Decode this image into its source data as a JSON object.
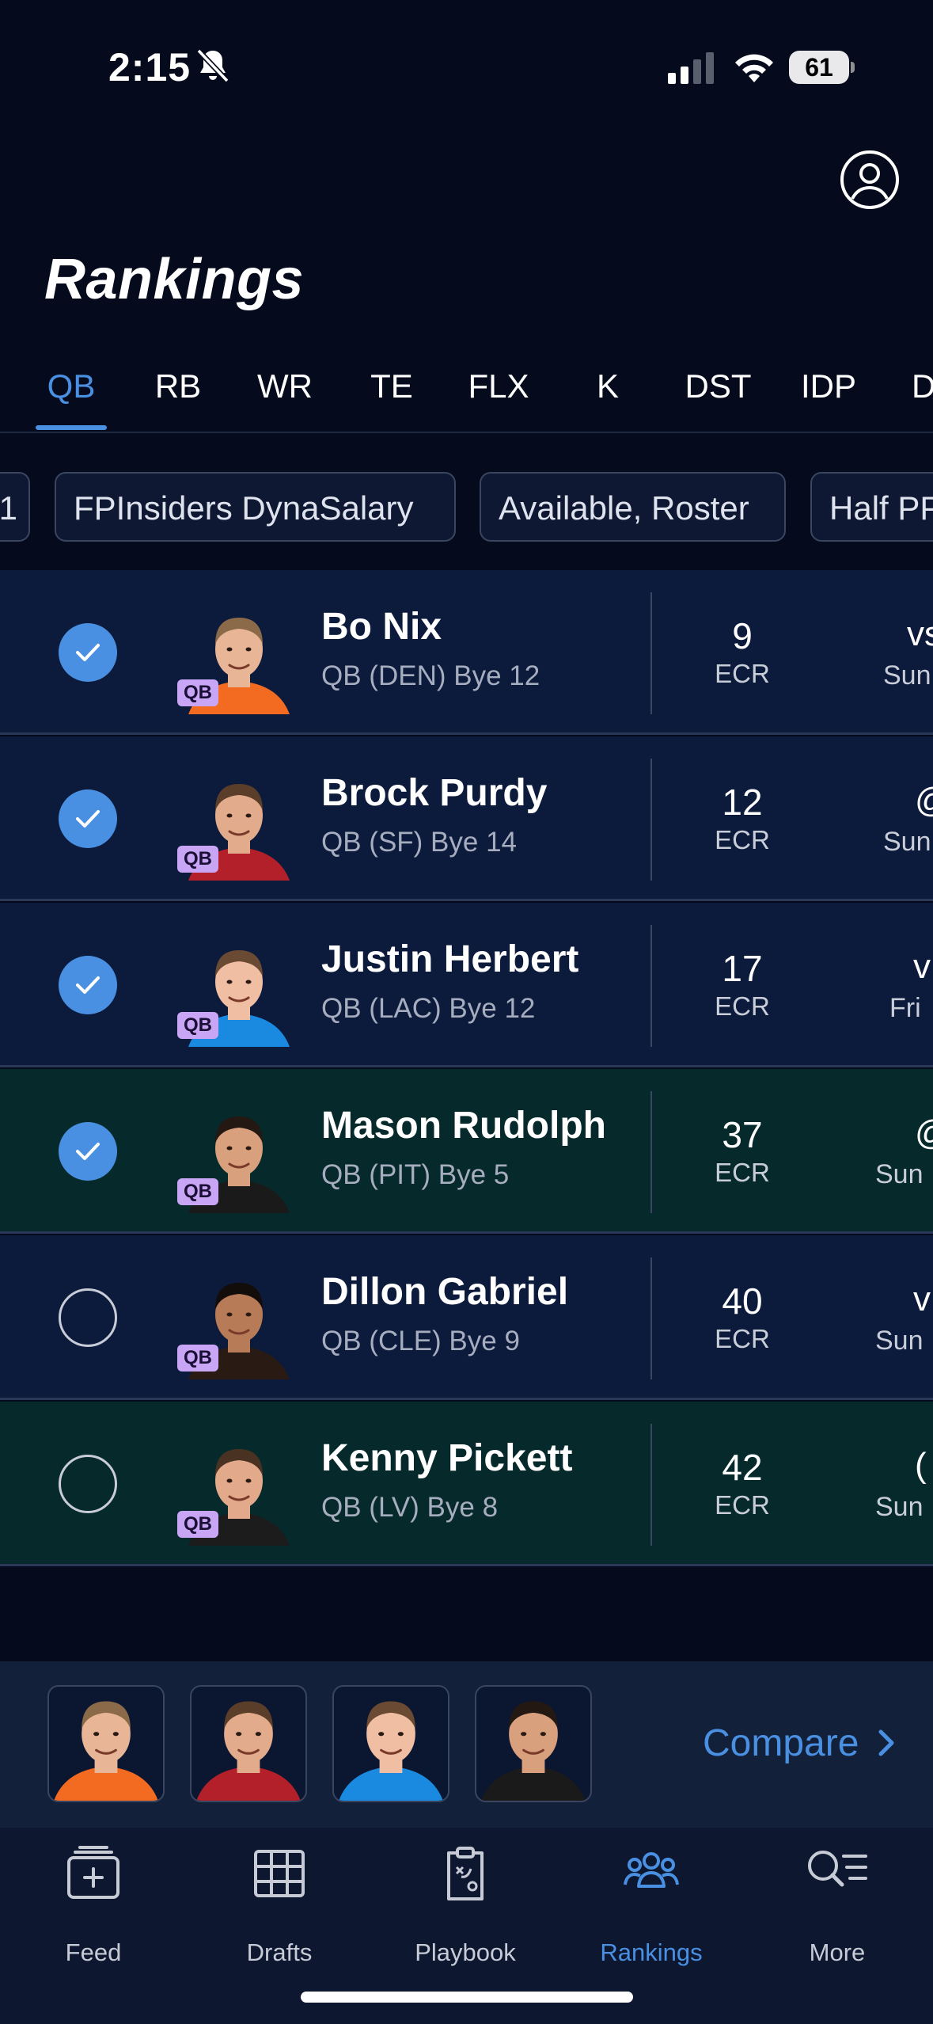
{
  "status_bar": {
    "time": "2:15",
    "battery": "61"
  },
  "header": {
    "title": "Rankings"
  },
  "tabs": [
    {
      "label": "QB",
      "active": true
    },
    {
      "label": "RB"
    },
    {
      "label": "WR"
    },
    {
      "label": "TE"
    },
    {
      "label": "FLX"
    },
    {
      "label": "K"
    },
    {
      "label": "DST"
    },
    {
      "label": "IDP"
    },
    {
      "label": "D"
    }
  ],
  "filters": [
    {
      "label": "1"
    },
    {
      "label": "FPInsiders DynaSalary"
    },
    {
      "label": "Available, Roster"
    },
    {
      "label": "Half PP"
    }
  ],
  "players": [
    {
      "name": "Bo Nix",
      "info": "QB (DEN) Bye 12",
      "pos": "QB",
      "ecr": "9",
      "ecr_label": "ECR",
      "opp": "vs",
      "day": "Sun",
      "checked": true,
      "row_color": "blue",
      "jersey": "#f36b21",
      "skin": "#e8b596",
      "hair": "#8b6a4a"
    },
    {
      "name": "Brock Purdy",
      "info": "QB (SF) Bye 14",
      "pos": "QB",
      "ecr": "12",
      "ecr_label": "ECR",
      "opp": "@",
      "day": "Sun",
      "checked": true,
      "row_color": "blue",
      "jersey": "#b3202a",
      "skin": "#e2ac8c",
      "hair": "#5a3e2a"
    },
    {
      "name": "Justin Herbert",
      "info": "QB (LAC) Bye 12",
      "pos": "QB",
      "ecr": "17",
      "ecr_label": "ECR",
      "opp": "v",
      "day": "Fri",
      "checked": true,
      "row_color": "blue",
      "jersey": "#1a8ae0",
      "skin": "#efbea3",
      "hair": "#6a4a32"
    },
    {
      "name": "Mason Rudolph",
      "info": "QB (PIT) Bye 5",
      "pos": "QB",
      "ecr": "37",
      "ecr_label": "ECR",
      "opp": "@",
      "day": "Sun",
      "checked": true,
      "row_color": "green",
      "jersey": "#1a1a1a",
      "skin": "#d9a07e",
      "hair": "#241812"
    },
    {
      "name": "Dillon Gabriel",
      "info": "QB (CLE) Bye 9",
      "pos": "QB",
      "ecr": "40",
      "ecr_label": "ECR",
      "opp": "v",
      "day": "Sun",
      "checked": false,
      "row_color": "blue",
      "jersey": "#2a1a14",
      "skin": "#b77b58",
      "hair": "#120c0a"
    },
    {
      "name": "Kenny Pickett",
      "info": "QB (LV) Bye 8",
      "pos": "QB",
      "ecr": "42",
      "ecr_label": "ECR",
      "opp": "(",
      "day": "Sun",
      "checked": false,
      "row_color": "green",
      "jersey": "#1c1c1c",
      "skin": "#e2aa8a",
      "hair": "#4a3222"
    }
  ],
  "compare": {
    "label": "Compare",
    "chevron": "chevron-right-icon"
  },
  "nav": [
    {
      "label": "Feed",
      "icon": "feed-icon"
    },
    {
      "label": "Drafts",
      "icon": "drafts-grid-icon"
    },
    {
      "label": "Playbook",
      "icon": "playbook-clipboard-icon"
    },
    {
      "label": "Rankings",
      "icon": "rankings-people-icon",
      "active": true
    },
    {
      "label": "More",
      "icon": "more-search-list-icon"
    }
  ],
  "colors": {
    "accent": "#4a90e2",
    "row_blue": "#0c1a3c",
    "row_green": "#062a2c",
    "badge": "#c9a6f5",
    "background": "#050b1d"
  }
}
